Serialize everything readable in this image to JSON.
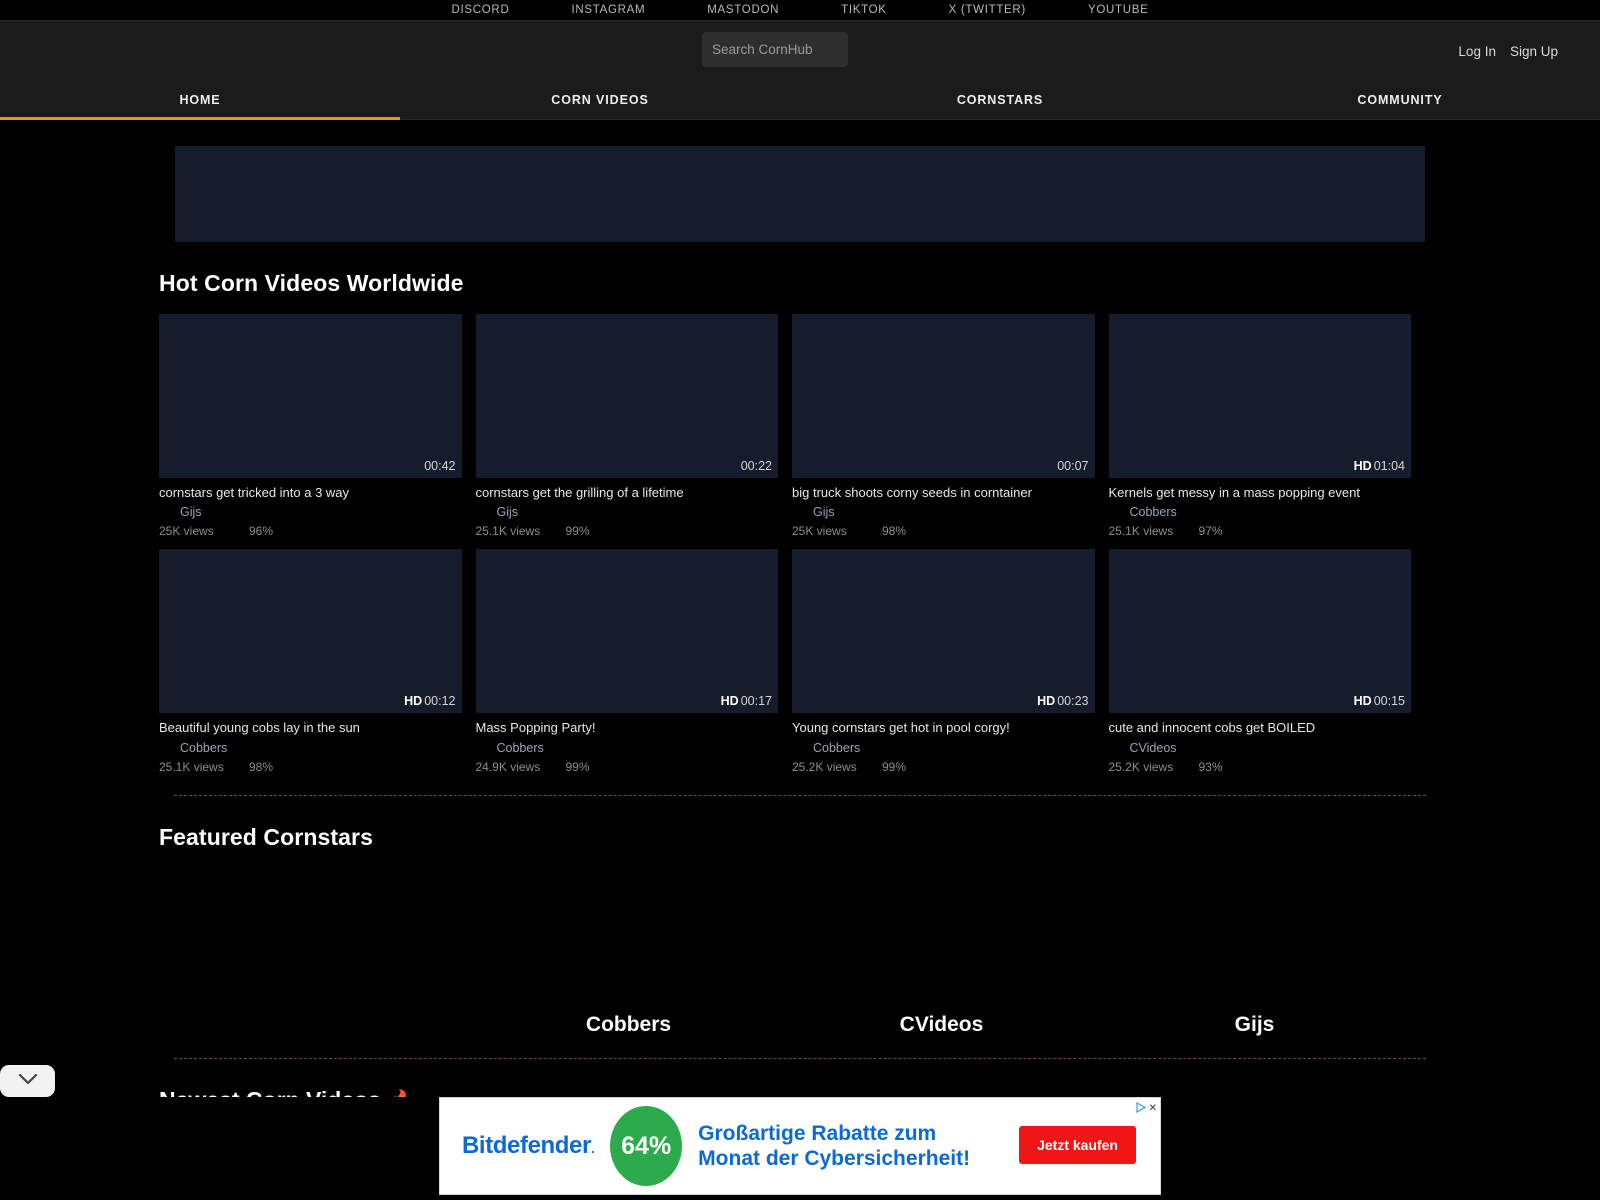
{
  "social_bar": {
    "links": [
      "DISCORD",
      "INSTAGRAM",
      "MASTODON",
      "TIKTOK",
      "X (TWITTER)",
      "YOUTUBE"
    ]
  },
  "header": {
    "search_placeholder": "Search CornHub",
    "search_value": "",
    "login_label": "Log In",
    "signup_label": "Sign Up"
  },
  "nav": {
    "tabs": [
      {
        "label": "HOME",
        "active": true
      },
      {
        "label": "CORN VIDEOS",
        "active": false
      },
      {
        "label": "CORNSTARS",
        "active": false
      },
      {
        "label": "COMMUNITY",
        "active": false
      }
    ]
  },
  "sections": {
    "hot_title": "Hot Corn Videos Worldwide",
    "featured_title": "Featured Cornstars",
    "newest_title": "Newest Corn Videos",
    "newest_emoji": "🔥"
  },
  "videos": [
    {
      "title": "cornstars get tricked into a 3 way",
      "uploader": "Gijs",
      "views": "25K views",
      "rating": "96%",
      "duration": "00:42",
      "hd": ""
    },
    {
      "title": "cornstars get the grilling of a lifetime",
      "uploader": "Gijs",
      "views": "25.1K views",
      "rating": "99%",
      "duration": "00:22",
      "hd": ""
    },
    {
      "title": "big truck shoots corny seeds in corntainer",
      "uploader": "Gijs",
      "views": "25K views",
      "rating": "98%",
      "duration": "00:07",
      "hd": ""
    },
    {
      "title": "Kernels get messy in a mass popping event",
      "uploader": "Cobbers",
      "views": "25.1K views",
      "rating": "97%",
      "duration": "01:04",
      "hd": "HD"
    },
    {
      "title": "Beautiful young cobs lay in the sun",
      "uploader": "Cobbers",
      "views": "25.1K views",
      "rating": "98%",
      "duration": "00:12",
      "hd": "HD"
    },
    {
      "title": "Mass Popping Party!",
      "uploader": "Cobbers",
      "views": "24.9K views",
      "rating": "99%",
      "duration": "00:17",
      "hd": "HD"
    },
    {
      "title": "Young cornstars get hot in pool corgy!",
      "uploader": "Cobbers",
      "views": "25.2K views",
      "rating": "99%",
      "duration": "00:23",
      "hd": "HD"
    },
    {
      "title": "cute and innocent cobs get BOILED",
      "uploader": "CVideos",
      "views": "25.2K views",
      "rating": "93%",
      "duration": "00:15",
      "hd": "HD"
    }
  ],
  "cornstars": [
    {
      "name": ""
    },
    {
      "name": "Cobbers"
    },
    {
      "name": "CVideos"
    },
    {
      "name": "Gijs"
    }
  ],
  "sticky_ad": {
    "brand": "Bitdefender",
    "brand_mark": ".",
    "discount": "64%",
    "headline_line1": "Großartige Rabatte zum",
    "headline_line2": "Monat der Cybersicherheit!",
    "cta_label": "Jetzt kaufen",
    "adchoices_label": "✕"
  },
  "colors": {
    "accent": "#ff9000",
    "thumb": "#151c2c",
    "ad_blue": "#0b6ad4",
    "ad_green": "#2bab4b",
    "ad_red": "#f01616"
  }
}
